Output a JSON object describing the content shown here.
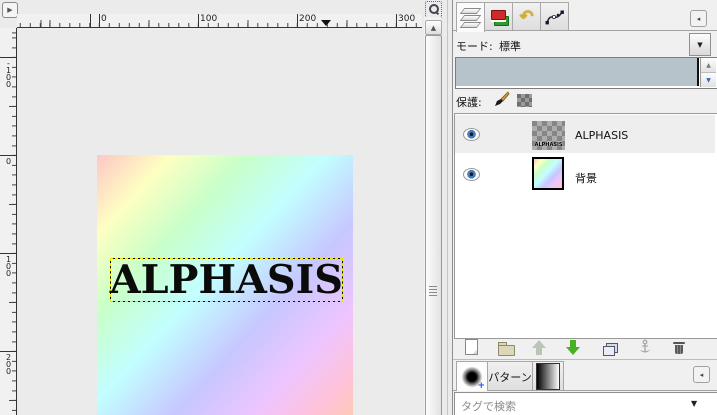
{
  "icons": {
    "corner_menu": "▶",
    "dock_menu": "◂",
    "dropdown": "▼",
    "spin_up": "▲",
    "spin_down": "▼",
    "scroll_up": "▲",
    "undo": "↶",
    "brush_plus": "+"
  },
  "h_ruler": {
    "labels": [
      "0",
      "100",
      "200",
      "300"
    ]
  },
  "v_ruler": {
    "labels": [
      "-100",
      "0",
      "100",
      "200"
    ]
  },
  "canvas": {
    "text": "ALPHASIS"
  },
  "dock": {
    "mode_label": "モード:",
    "mode_value": "標準",
    "lock_label": "保護:",
    "layers": [
      {
        "name": "ALPHASIS",
        "thumb_text": "ALPHASIS",
        "visible": true,
        "selected": true
      },
      {
        "name": "背景",
        "visible": true,
        "selected": false
      }
    ],
    "bottom_tabs": {
      "patterns_label": "パターン"
    },
    "search_placeholder": "タグで検索"
  },
  "colors": {
    "dock_bg": "#f0f0f0",
    "canvas_bg": "#ebebeb",
    "opacity_fill": "#b7c3cb",
    "selection_ants": "#e9e900",
    "arrow_green": "#47b025"
  }
}
